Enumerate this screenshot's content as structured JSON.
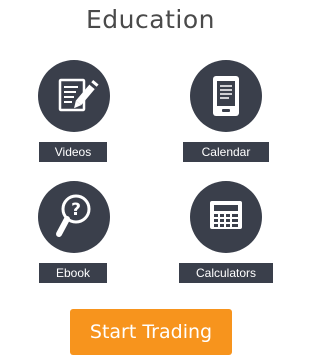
{
  "page": {
    "title": "Education"
  },
  "tiles": [
    {
      "label": "Videos",
      "icon": "edit-document-icon"
    },
    {
      "label": "Calendar",
      "icon": "ereader-device-icon"
    },
    {
      "label": "Ebook",
      "icon": "magnifier-question-icon"
    },
    {
      "label": "Calculators",
      "icon": "calculator-icon"
    }
  ],
  "cta": {
    "label": "Start Trading"
  },
  "colors": {
    "tile_background": "#3a3f4b",
    "icon_foreground": "#ffffff",
    "cta_background": "#f7941d",
    "title_text": "#4a4a4a"
  }
}
